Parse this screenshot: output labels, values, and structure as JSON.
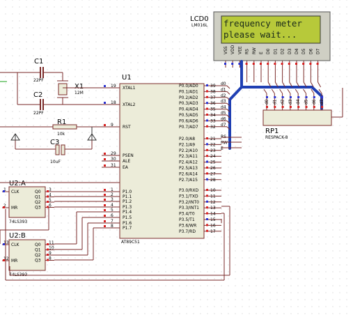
{
  "colors": {
    "wire": "#7a2a28",
    "bus": "#1f3fb3",
    "chip_fill": "#ececd9",
    "lcd_screen": "#b7c93a",
    "pin_red": "#d72020",
    "pin_blue": "#2a32d0"
  },
  "lcd": {
    "ref": "LCD0",
    "part": "LM016L",
    "line1": "frequency meter",
    "line2": " please wait...",
    "pins": [
      "VSS",
      "VDD",
      "VEE",
      "RS",
      "RW",
      "E",
      "D0",
      "D1",
      "D2",
      "D3",
      "D4",
      "D5",
      "D6",
      "D7"
    ]
  },
  "u1": {
    "ref": "U1",
    "part": "AT89C51",
    "left_pins": [
      "XTAL1",
      "XTAL2",
      "RST",
      "PSEN",
      "ALE",
      "EA",
      "P1.0",
      "P1.1",
      "P1.2",
      "P1.3",
      "P1.4",
      "P1.5",
      "P1.6",
      "P1.7"
    ],
    "left_nums": [
      "19",
      "18",
      "9",
      "29",
      "30",
      "31",
      "1",
      "2",
      "3",
      "4",
      "5",
      "6",
      "7",
      "8"
    ],
    "right_pins": [
      "P0.0/AD0",
      "P0.1/AD1",
      "P0.2/AD2",
      "P0.3/AD3",
      "P0.4/AD4",
      "P0.5/AD5",
      "P0.6/AD6",
      "P0.7/AD7",
      "P2.0/A8",
      "P2.1/A9",
      "P2.2/A10",
      "P2.3/A11",
      "P2.4/A12",
      "P2.5/A13",
      "P2.6/A14",
      "P2.7/A15",
      "P3.0/RXD",
      "P3.1/TXD",
      "P3.2/INT0",
      "P3.3/INT1",
      "P3.4/T0",
      "P3.5/T1",
      "P3.6/WR",
      "P3.7/RD"
    ],
    "right_nums": [
      "39",
      "38",
      "37",
      "36",
      "35",
      "34",
      "33",
      "32",
      "21",
      "22",
      "23",
      "24",
      "25",
      "26",
      "27",
      "28",
      "10",
      "11",
      "12",
      "13",
      "14",
      "15",
      "16",
      "17"
    ],
    "bus_labels": [
      "d0",
      "d1",
      "d2",
      "d3",
      "d4",
      "d5",
      "d6",
      "d7"
    ],
    "ctrl_labels": [
      "RS",
      "RW",
      "E"
    ]
  },
  "crystal": {
    "c1": "C1",
    "c1_val": "22PF",
    "c2": "C2",
    "c2_val": "22PF",
    "x1": "X1",
    "x1_val": "12M"
  },
  "reset": {
    "r1": "R1",
    "r1_val": "10k",
    "c3": "C3",
    "c3_val": "10uF"
  },
  "rp1": {
    "ref": "RP1",
    "part": "RESPACK-8",
    "pin_labels": [
      "d0",
      "d1",
      "d2",
      "d3",
      "d4",
      "d5",
      "d6",
      "d7"
    ]
  },
  "u2a": {
    "ref": "U2:A",
    "part": "74LS393",
    "pins": [
      "CLK",
      "MR",
      "Q0",
      "Q1",
      "Q2",
      "Q3"
    ],
    "nums": [
      "1",
      "2",
      "3",
      "4",
      "5",
      "6"
    ]
  },
  "u2b": {
    "ref": "U2:B",
    "part": "74LS393",
    "pins": [
      "CLK",
      "MR",
      "Q0",
      "Q1",
      "Q2",
      "Q3"
    ],
    "nums": [
      "13",
      "12",
      "11",
      "10",
      "9",
      "8"
    ]
  }
}
